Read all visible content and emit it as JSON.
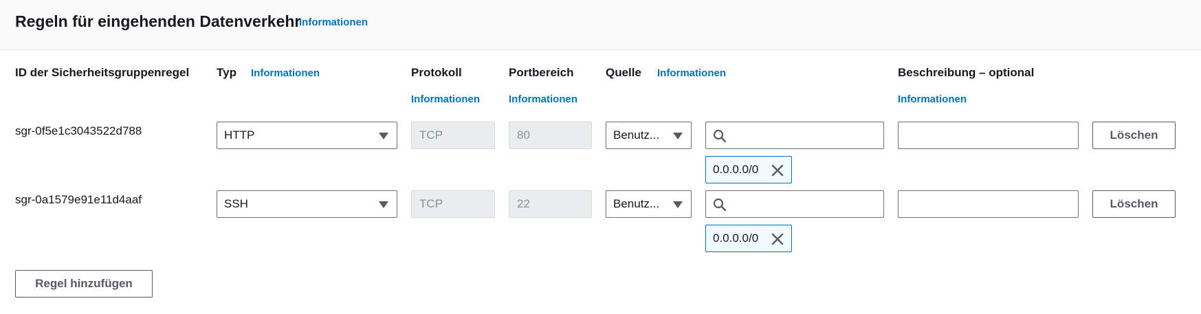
{
  "header": {
    "title": "Regeln für eingehenden Datenverkehr",
    "info_label": "Informationen"
  },
  "columns": {
    "id": "ID der Sicherheitsgruppenregel",
    "type": "Typ",
    "type_info": "Informationen",
    "protocol": "Protokoll",
    "protocol_info": "Informationen",
    "port_range": "Portbereich",
    "port_range_info": "Informationen",
    "source": "Quelle",
    "source_info": "Informationen",
    "description": "Beschreibung – optional",
    "description_info": "Informationen"
  },
  "rules": [
    {
      "id": "sgr-0f5e1c3043522d788",
      "type": "HTTP",
      "protocol": "TCP",
      "port": "80",
      "source_type": "Benutz...",
      "source_search_value": "",
      "source_token": "0.0.0.0/0",
      "description": "",
      "delete_label": "Löschen"
    },
    {
      "id": "sgr-0a1579e91e11d4aaf",
      "type": "SSH",
      "protocol": "TCP",
      "port": "22",
      "source_type": "Benutz...",
      "source_search_value": "",
      "source_token": "0.0.0.0/0",
      "description": "",
      "delete_label": "Löschen"
    }
  ],
  "add_rule_label": "Regel hinzufügen",
  "icons": {
    "search": "search-icon",
    "dropdown": "caret-down-icon",
    "remove": "close-icon"
  },
  "colors": {
    "link": "#0073bb",
    "header_bg": "#fafafa",
    "disabled_bg": "#eaeded",
    "token_bg": "#f1faff"
  }
}
